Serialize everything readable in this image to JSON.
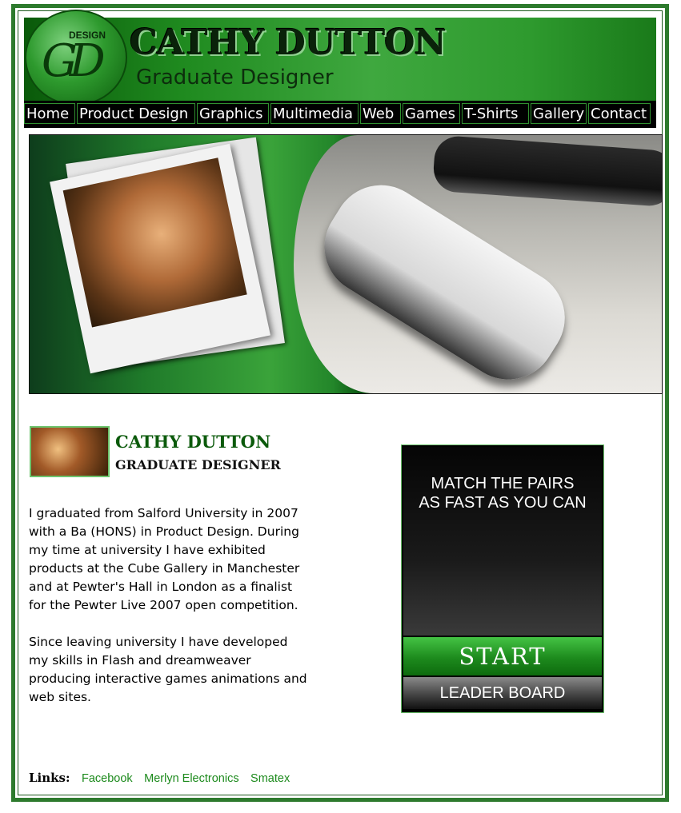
{
  "header": {
    "logo_small": "DESIGN",
    "logo_letters": "GD",
    "title": "CATHY DUTTON",
    "subtitle": "Graduate Designer"
  },
  "nav": {
    "items": [
      "Home",
      "Product Design",
      "Graphics",
      "Multimedia",
      "Web",
      "Games",
      "T-Shirts",
      "Gallery",
      "Contact"
    ]
  },
  "intro": {
    "name": "CATHY DUTTON",
    "role": "GRADUATE DESIGNER",
    "paragraph1": "I graduated from Salford University in 2007 with a Ba (HONS) in Product Design. During my time at university I have exhibited products at the Cube Gallery in Manchester and at Pewter's Hall in London as a finalist for the Pewter Live 2007 open competition.",
    "paragraph2": "Since leaving university I have developed my skills in Flash and dreamweaver producing interactive games animations and web sites."
  },
  "game": {
    "title_line1": "MATCH THE PAIRS",
    "title_line2": "AS FAST AS YOU CAN",
    "start_label": "START",
    "leaderboard_label": "LEADER BOARD"
  },
  "links": {
    "label": "Links:",
    "items": [
      "Facebook",
      "Merlyn Electronics",
      "Smatex"
    ]
  },
  "colors": {
    "brand_green": "#2d7a2d",
    "link_green": "#1c8a1c",
    "nav_bg": "#000000"
  }
}
